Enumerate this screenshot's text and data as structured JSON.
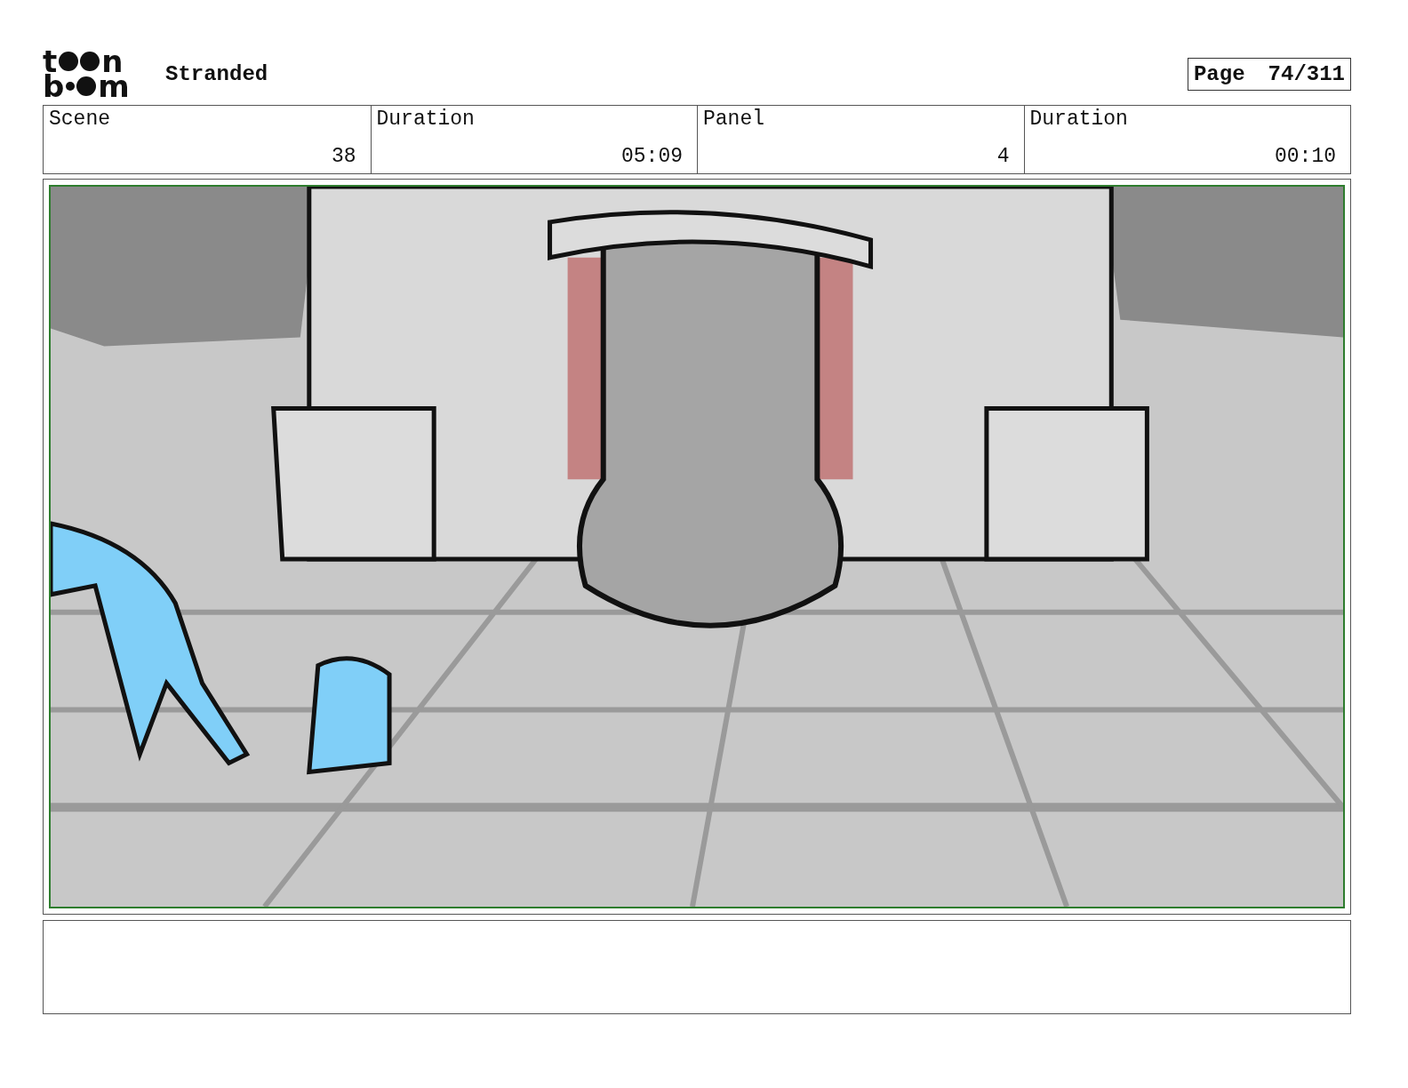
{
  "logo": {
    "letters": [
      "t",
      "n",
      "b",
      "m"
    ]
  },
  "project_title": "Stranded",
  "page": {
    "label": "Page",
    "number": "74/311"
  },
  "info_cells": [
    {
      "label": "Scene",
      "value": "38"
    },
    {
      "label": "Duration",
      "value": "05:09"
    },
    {
      "label": "Panel",
      "value": "4"
    },
    {
      "label": "Duration",
      "value": "00:10"
    }
  ]
}
